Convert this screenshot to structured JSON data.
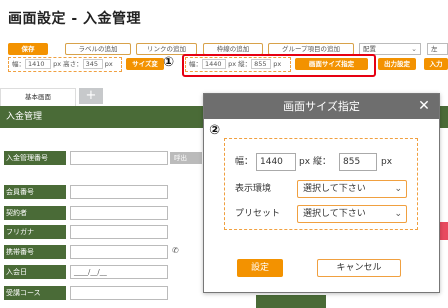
{
  "page": {
    "title": "画面設定 - 入金管理"
  },
  "toolbar": {
    "save": "保存",
    "add_label": "ラベルの追加",
    "add_link": "リンクの追加",
    "add_frame": "枠線の追加",
    "add_group": "グループ項目の追加",
    "layout_select": "配置",
    "extra_select": "左",
    "size_group": {
      "width_label": "幅：",
      "width_value": "1410",
      "unit1": "px",
      "height_label": "高さ：",
      "height_value": "345",
      "unit2": "px"
    },
    "size_button": "サイズ変",
    "resize_group": {
      "width_label": "幅：",
      "width_value": "1440",
      "unit1": "px",
      "height_label": "縦：",
      "height_value": "855",
      "unit2": "px"
    },
    "screen_size_button": "画面サイズ指定",
    "output_settings": "出力設定",
    "input_button": "入力",
    "marker1": "①"
  },
  "tabs": {
    "basic": "基本画面",
    "add": "+"
  },
  "form": {
    "header": "入金管理",
    "fields": [
      {
        "label": "入金管理番号",
        "value": ""
      },
      {
        "label": "会員番号",
        "value": ""
      },
      {
        "label": "契約者",
        "value": ""
      },
      {
        "label": "フリガナ",
        "value": ""
      },
      {
        "label": "携帯番号",
        "value": ""
      },
      {
        "label": "入会日",
        "value": "____/__/__"
      },
      {
        "label": "受講コース",
        "value": ""
      }
    ],
    "call_button": "呼出",
    "phone_icon": "phone-icon"
  },
  "dialog": {
    "title": "画面サイズ指定",
    "close": "✕",
    "marker2": "②",
    "width_label": "幅：",
    "width_value": "1440",
    "unit1": "px",
    "height_label": "縦：",
    "height_value": "855",
    "unit2": "px",
    "env_label": "表示環境",
    "env_value": "選択して下さい",
    "preset_label": "プリセット",
    "preset_value": "選択して下さい",
    "ok": "設定",
    "cancel": "キャンセル"
  },
  "colors": {
    "accent": "#f39200",
    "form_green": "#4a6b37",
    "highlight_red": "#e60012",
    "dialog_header": "#6e6e6e"
  }
}
